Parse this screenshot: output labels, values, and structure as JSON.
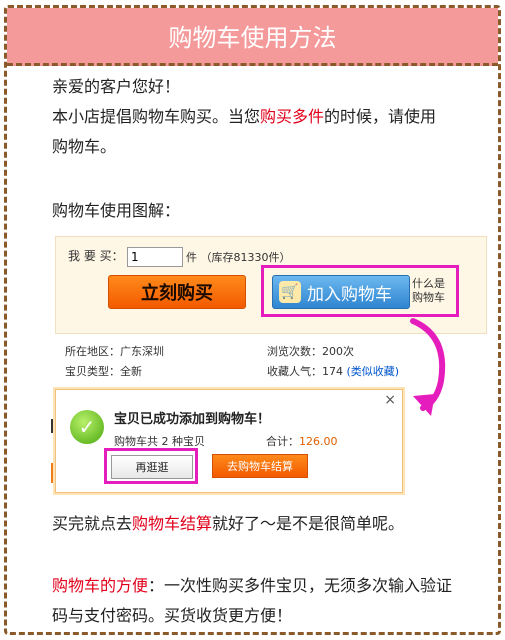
{
  "title": "购物车使用方法",
  "intro": {
    "line1": "亲爱的客户您好！",
    "line2_pre": "本小店提倡购物车购买。当您",
    "line2_hl": "购买多件",
    "line2_post": "的时候，请使用",
    "line3": "购物车。"
  },
  "diagram_heading": "购物车使用图解：",
  "buybox": {
    "qty_label": "我 要 买：",
    "qty_value": "1",
    "unit_text": "件 （库存81330件）",
    "buy_now": "立刻购买",
    "add_cart": "加入购物车",
    "cart_hint_line1": "什么是",
    "cart_hint_line2": "购物车"
  },
  "product_info": {
    "location": "所在地区：广东深圳",
    "type": "宝贝类型：全新",
    "views": "浏览次数：200次",
    "favorites_pre": "收藏人气：174",
    "favorites_link": "(类似收藏)"
  },
  "popup": {
    "message": "宝贝已成功添加到购物车！",
    "count": "购物车共 2 种宝贝",
    "total_label": "合计：",
    "total_amount": "126.00",
    "continue_btn": "再逛逛",
    "checkout_btn": "去购物车结算",
    "close": "×"
  },
  "after": {
    "pre": "买完就点去",
    "hl": "购物车结算",
    "post": "就好了～是不是很简单呢。"
  },
  "benefit": {
    "hl": "购物车的方便",
    "line1_post": "：一次性购买多件宝贝，无须多次输入验证",
    "line2": "码与支付密码。买货收货更方便！"
  },
  "colors": {
    "title_bg": "#f59a9a",
    "highlight": "#e61dbd",
    "accent_red": "#e0001a"
  }
}
